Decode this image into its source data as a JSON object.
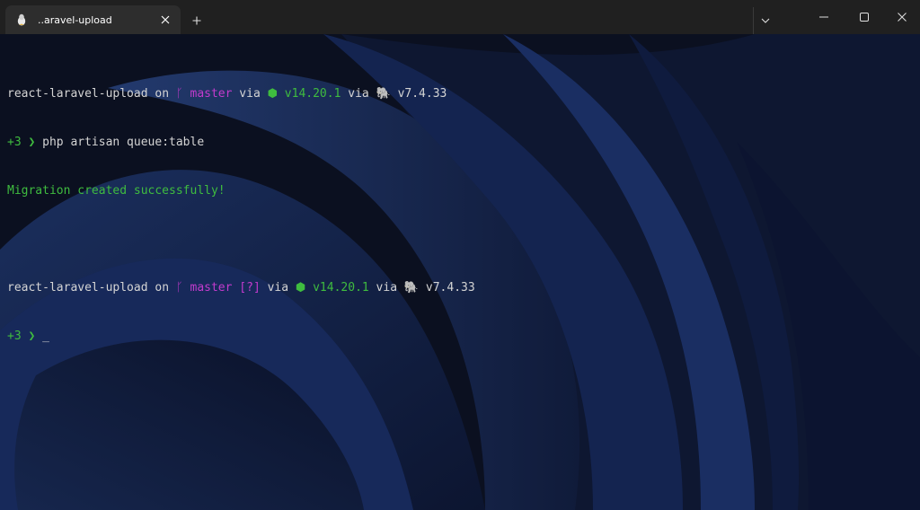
{
  "window": {
    "tab": {
      "title": "..aravel-upload",
      "icon": "linux-tux-icon"
    },
    "controls": [
      "new-tab",
      "dropdown",
      "minimize",
      "maximize",
      "close"
    ]
  },
  "terminal": {
    "prompt1": {
      "dir": "react-laravel-upload",
      "on": " on ",
      "branch_icon": "git-branch-icon",
      "branch": " master",
      "via1": " via ",
      "node_icon": "nodejs-icon",
      "node_version": " v14.20.1",
      "via2": " via ",
      "php_icon": "php-elephant-icon",
      "php_version": " v7.4.33"
    },
    "command_line": {
      "prefix": "+3",
      "chevron": "❯",
      "command": " php artisan queue:table"
    },
    "output": "Migration created successfully!",
    "prompt2": {
      "dir": "react-laravel-upload",
      "on": " on ",
      "branch_icon": "git-branch-icon",
      "branch": " master",
      "status": " [?]",
      "via1": " via ",
      "node_icon": "nodejs-icon",
      "node_version": " v14.20.1",
      "via2": " via ",
      "php_icon": "php-elephant-icon",
      "php_version": " v7.4.33"
    },
    "input_line": {
      "prefix": "+3",
      "chevron": "❯",
      "cursor": "_"
    }
  },
  "colors": {
    "magenta": "#c33bcd",
    "green": "#3fbc3f",
    "text": "#d4d4d4",
    "titlebar": "#202020",
    "tab": "#2d2d2d"
  }
}
